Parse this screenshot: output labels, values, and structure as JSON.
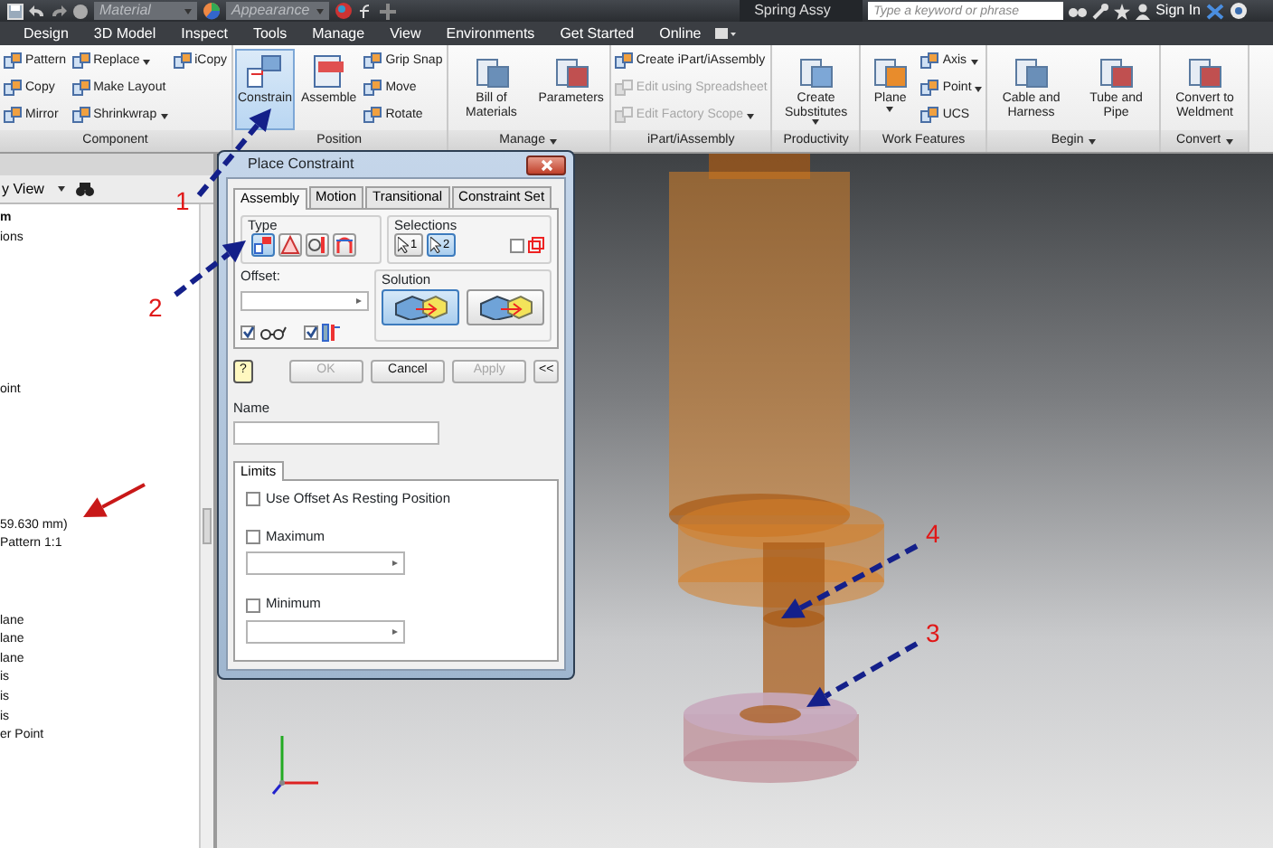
{
  "top_bar": {
    "material": "Material",
    "appearance": "Appearance",
    "document_title": "Spring Assy",
    "search": {
      "placeholder": "Type a keyword or phrase"
    },
    "sign_in": "Sign In"
  },
  "menu_tabs": [
    {
      "label": "Design",
      "selected": false
    },
    {
      "label": "3D Model",
      "selected": false
    },
    {
      "label": "Inspect",
      "selected": false
    },
    {
      "label": "Tools",
      "selected": false
    },
    {
      "label": "Manage",
      "selected": false
    },
    {
      "label": "View",
      "selected": false
    },
    {
      "label": "Environments",
      "selected": false
    },
    {
      "label": "Get Started",
      "selected": false
    },
    {
      "label": "Online",
      "selected": false
    }
  ],
  "ribbon": {
    "groups": [
      {
        "label": "Component",
        "menu": false,
        "items": [
          {
            "kind": "small",
            "label": "Pattern",
            "disabled": false,
            "selected": false,
            "caret": false
          },
          {
            "kind": "small",
            "label": "Copy",
            "disabled": false,
            "selected": false,
            "caret": false
          },
          {
            "kind": "small",
            "label": "Mirror",
            "disabled": false,
            "selected": false,
            "caret": false
          },
          {
            "kind": "small",
            "label": "Replace",
            "disabled": false,
            "selected": false,
            "caret": true
          },
          {
            "kind": "small",
            "label": "Make Layout",
            "disabled": false,
            "selected": false,
            "caret": false
          },
          {
            "kind": "small",
            "label": "Shrinkwrap",
            "disabled": false,
            "selected": false,
            "caret": true
          },
          {
            "kind": "small",
            "label": "iCopy",
            "disabled": false,
            "selected": false,
            "caret": false
          }
        ]
      },
      {
        "label": "Position",
        "menu": false,
        "items": [
          {
            "kind": "large",
            "label": "Constrain",
            "disabled": false,
            "selected": true,
            "caret": false
          },
          {
            "kind": "large",
            "label": "Assemble",
            "disabled": false,
            "selected": false,
            "caret": false
          },
          {
            "kind": "small",
            "label": "Grip Snap",
            "disabled": false,
            "selected": false,
            "caret": false
          },
          {
            "kind": "small",
            "label": "Move",
            "disabled": false,
            "selected": false,
            "caret": false
          },
          {
            "kind": "small",
            "label": "Rotate",
            "disabled": false,
            "selected": false,
            "caret": false
          }
        ]
      },
      {
        "label": "Manage",
        "menu": true,
        "items": [
          {
            "kind": "large",
            "label": "Bill of Materials",
            "disabled": false,
            "selected": false,
            "caret": false
          },
          {
            "kind": "large",
            "label": "Parameters",
            "disabled": false,
            "selected": false,
            "caret": false
          }
        ]
      },
      {
        "label": "iPart/iAssembly",
        "menu": false,
        "items": [
          {
            "kind": "small",
            "label": "Create iPart/iAssembly",
            "disabled": false,
            "selected": false,
            "caret": false
          },
          {
            "kind": "small",
            "label": "Edit using Spreadsheet",
            "disabled": true,
            "selected": false,
            "caret": false
          },
          {
            "kind": "small",
            "label": "Edit Factory Scope",
            "disabled": true,
            "selected": false,
            "caret": true
          }
        ]
      },
      {
        "label": "Productivity",
        "menu": false,
        "items": [
          {
            "kind": "large",
            "label": "Create Substitutes",
            "disabled": false,
            "selected": false,
            "caret": true
          }
        ]
      },
      {
        "label": "Work Features",
        "menu": false,
        "items": [
          {
            "kind": "large",
            "label": "Plane",
            "disabled": false,
            "selected": false,
            "caret": true
          },
          {
            "kind": "small",
            "label": "Axis",
            "disabled": false,
            "selected": false,
            "caret": true
          },
          {
            "kind": "small",
            "label": "Point",
            "disabled": false,
            "selected": false,
            "caret": true
          },
          {
            "kind": "small",
            "label": "UCS",
            "disabled": false,
            "selected": false,
            "caret": false
          }
        ]
      },
      {
        "label": "Begin",
        "menu": true,
        "items": [
          {
            "kind": "large",
            "label": "Cable and Harness",
            "disabled": false,
            "selected": false,
            "caret": false
          },
          {
            "kind": "large",
            "label": "Tube and Pipe",
            "disabled": false,
            "selected": false,
            "caret": false
          }
        ]
      },
      {
        "label": "Convert",
        "menu": true,
        "items": [
          {
            "kind": "large",
            "label": "Convert to Weldment",
            "disabled": false,
            "selected": false,
            "caret": false
          }
        ]
      }
    ]
  },
  "browser": {
    "view_label": "y View",
    "tree": [
      {
        "label": "m",
        "bold": true
      },
      {
        "label": "ions",
        "bold": false
      },
      {
        "label": "oint",
        "bold": false
      },
      {
        "label": "59.630 mm)",
        "bold": false
      },
      {
        "label": "Pattern 1:1",
        "bold": false
      },
      {
        "label": "lane",
        "bold": false
      },
      {
        "label": "lane",
        "bold": false
      },
      {
        "label": "lane",
        "bold": false
      },
      {
        "label": "is",
        "bold": false
      },
      {
        "label": "is",
        "bold": false
      },
      {
        "label": "is",
        "bold": false
      },
      {
        "label": "er Point",
        "bold": false
      }
    ]
  },
  "dialog": {
    "title": "Place Constraint",
    "tabs": [
      {
        "label": "Assembly",
        "selected": true
      },
      {
        "label": "Motion",
        "selected": false
      },
      {
        "label": "Transitional",
        "selected": false
      },
      {
        "label": "Constraint Set",
        "selected": false
      }
    ],
    "type_label": "Type",
    "types": [
      {
        "selected": true
      },
      {
        "selected": false
      },
      {
        "selected": false
      },
      {
        "selected": false
      }
    ],
    "selections_label": "Selections",
    "selections": [
      {
        "label": "1",
        "selected": false
      },
      {
        "label": "2",
        "selected": true
      }
    ],
    "pick_part_first": {
      "checked": false
    },
    "offset_label": "Offset:",
    "show_preview": {
      "checked": true
    },
    "predict_offset": {
      "checked": true
    },
    "solution_label": "Solution",
    "solutions": [
      {
        "selected": true
      },
      {
        "selected": false
      }
    ],
    "help_button": "?",
    "buttons": [
      {
        "label": "OK",
        "disabled": true
      },
      {
        "label": "Cancel",
        "disabled": false
      },
      {
        "label": "Apply",
        "disabled": true
      }
    ],
    "more_button": "<<",
    "name_label": "Name",
    "limits_tab": "Limits",
    "limits": [
      {
        "kind": "checkbox",
        "label": "Use Offset As Resting Position",
        "checked": false
      },
      {
        "kind": "checkbox_field",
        "label": "Maximum",
        "checked": false
      },
      {
        "kind": "checkbox_field",
        "label": "Minimum",
        "checked": false
      }
    ]
  },
  "annotations": [
    {
      "label": "1"
    },
    {
      "label": "2"
    },
    {
      "label": "4"
    },
    {
      "label": "3"
    }
  ]
}
